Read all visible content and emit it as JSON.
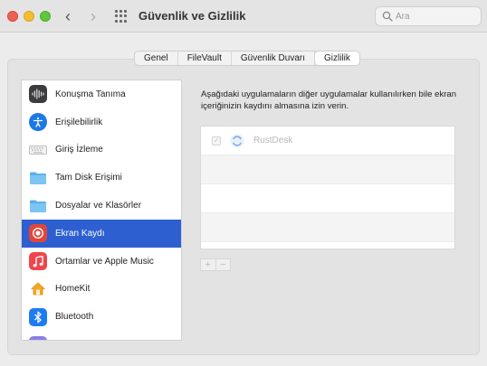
{
  "window": {
    "title": "Güvenlik ve Gizlilik"
  },
  "search": {
    "placeholder": "Ara"
  },
  "tabs": [
    {
      "label": "Genel",
      "active": false
    },
    {
      "label": "FileVault",
      "active": false
    },
    {
      "label": "Güvenlik Duvarı",
      "active": false
    },
    {
      "label": "Gizlilik",
      "active": true
    }
  ],
  "sidebar": {
    "items": [
      {
        "label": "Konuşma Tanıma",
        "icon": "waveform-icon"
      },
      {
        "label": "Erişilebilirlik",
        "icon": "accessibility-icon"
      },
      {
        "label": "Giriş İzleme",
        "icon": "keyboard-icon"
      },
      {
        "label": "Tam Disk Erişimi",
        "icon": "folder-icon"
      },
      {
        "label": "Dosyalar ve Klasörler",
        "icon": "folder-icon"
      },
      {
        "label": "Ekran Kaydı",
        "icon": "screen-record-icon",
        "selected": true
      },
      {
        "label": "Ortamlar ve Apple Music",
        "icon": "music-icon"
      },
      {
        "label": "HomeKit",
        "icon": "home-icon"
      },
      {
        "label": "Bluetooth",
        "icon": "bluetooth-icon"
      }
    ]
  },
  "main": {
    "description": "Aşağıdaki uygulamaların diğer uygulamalar kullanılırken bile ekran içeriğinizin kaydını almasına izin verin.",
    "apps": [
      {
        "name": "RustDesk",
        "checked": true,
        "icon": "rustdesk-icon"
      }
    ],
    "add_label": "+",
    "remove_label": "−"
  },
  "colors": {
    "accent": "#2d5fd1",
    "record": "#e2463a",
    "music": "#f0454c"
  }
}
